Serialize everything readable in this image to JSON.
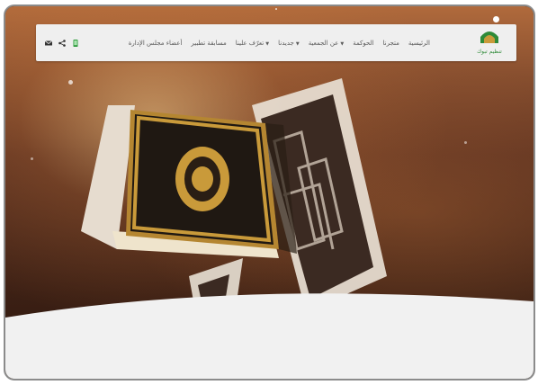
{
  "logo": {
    "text": "تنظيم تبوك"
  },
  "nav": {
    "items": [
      {
        "label": "الرئيسية",
        "dropdown": false
      },
      {
        "label": "متجرنا",
        "dropdown": false
      },
      {
        "label": "الحوكمة",
        "dropdown": false
      },
      {
        "label": "عن الجمعية",
        "dropdown": true
      },
      {
        "label": "جديدنا",
        "dropdown": true
      },
      {
        "label": "تعرّف علينا",
        "dropdown": true
      },
      {
        "label": "مسابقة تطبير",
        "dropdown": false
      },
      {
        "label": "أعضاء مجلس الإدارة",
        "dropdown": false
      }
    ]
  },
  "icons": [
    "mail-icon",
    "share-icon",
    "phone-icon"
  ],
  "colors": {
    "nav_bg": "#efefef",
    "logo_green": "#2e8a38",
    "brand_gold": "#c99a3a"
  }
}
